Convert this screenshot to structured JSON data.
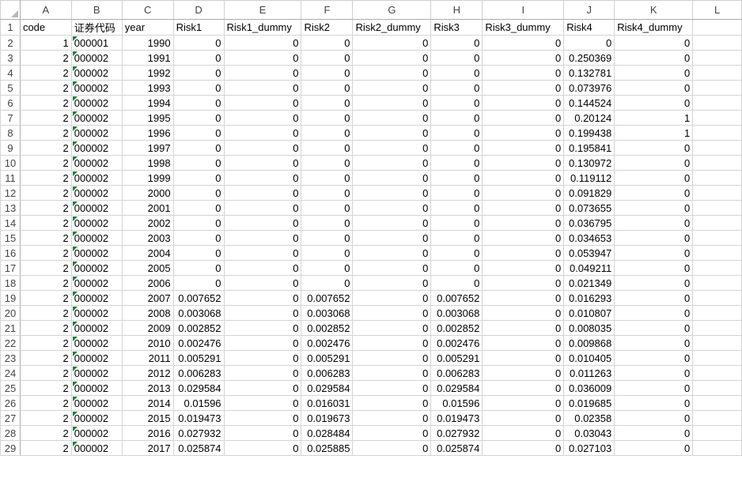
{
  "columns": [
    "A",
    "B",
    "C",
    "D",
    "E",
    "F",
    "G",
    "H",
    "I",
    "J",
    "K",
    "L"
  ],
  "header_row": [
    "code",
    "证券代码",
    "year",
    "Risk1",
    "Risk1_dummy",
    "Risk2",
    "Risk2_dummy",
    "Risk3",
    "Risk3_dummy",
    "Risk4",
    "Risk4_dummy",
    ""
  ],
  "rows": [
    [
      "1",
      "000001",
      "1990",
      "0",
      "0",
      "0",
      "0",
      "0",
      "0",
      "0",
      "0"
    ],
    [
      "2",
      "000002",
      "1991",
      "0",
      "0",
      "0",
      "0",
      "0",
      "0",
      "0.250369",
      "0"
    ],
    [
      "2",
      "000002",
      "1992",
      "0",
      "0",
      "0",
      "0",
      "0",
      "0",
      "0.132781",
      "0"
    ],
    [
      "2",
      "000002",
      "1993",
      "0",
      "0",
      "0",
      "0",
      "0",
      "0",
      "0.073976",
      "0"
    ],
    [
      "2",
      "000002",
      "1994",
      "0",
      "0",
      "0",
      "0",
      "0",
      "0",
      "0.144524",
      "0"
    ],
    [
      "2",
      "000002",
      "1995",
      "0",
      "0",
      "0",
      "0",
      "0",
      "0",
      "0.20124",
      "1"
    ],
    [
      "2",
      "000002",
      "1996",
      "0",
      "0",
      "0",
      "0",
      "0",
      "0",
      "0.199438",
      "1"
    ],
    [
      "2",
      "000002",
      "1997",
      "0",
      "0",
      "0",
      "0",
      "0",
      "0",
      "0.195841",
      "0"
    ],
    [
      "2",
      "000002",
      "1998",
      "0",
      "0",
      "0",
      "0",
      "0",
      "0",
      "0.130972",
      "0"
    ],
    [
      "2",
      "000002",
      "1999",
      "0",
      "0",
      "0",
      "0",
      "0",
      "0",
      "0.119112",
      "0"
    ],
    [
      "2",
      "000002",
      "2000",
      "0",
      "0",
      "0",
      "0",
      "0",
      "0",
      "0.091829",
      "0"
    ],
    [
      "2",
      "000002",
      "2001",
      "0",
      "0",
      "0",
      "0",
      "0",
      "0",
      "0.073655",
      "0"
    ],
    [
      "2",
      "000002",
      "2002",
      "0",
      "0",
      "0",
      "0",
      "0",
      "0",
      "0.036795",
      "0"
    ],
    [
      "2",
      "000002",
      "2003",
      "0",
      "0",
      "0",
      "0",
      "0",
      "0",
      "0.034653",
      "0"
    ],
    [
      "2",
      "000002",
      "2004",
      "0",
      "0",
      "0",
      "0",
      "0",
      "0",
      "0.053947",
      "0"
    ],
    [
      "2",
      "000002",
      "2005",
      "0",
      "0",
      "0",
      "0",
      "0",
      "0",
      "0.049211",
      "0"
    ],
    [
      "2",
      "000002",
      "2006",
      "0",
      "0",
      "0",
      "0",
      "0",
      "0",
      "0.021349",
      "0"
    ],
    [
      "2",
      "000002",
      "2007",
      "0.007652",
      "0",
      "0.007652",
      "0",
      "0.007652",
      "0",
      "0.016293",
      "0"
    ],
    [
      "2",
      "000002",
      "2008",
      "0.003068",
      "0",
      "0.003068",
      "0",
      "0.003068",
      "0",
      "0.010807",
      "0"
    ],
    [
      "2",
      "000002",
      "2009",
      "0.002852",
      "0",
      "0.002852",
      "0",
      "0.002852",
      "0",
      "0.008035",
      "0"
    ],
    [
      "2",
      "000002",
      "2010",
      "0.002476",
      "0",
      "0.002476",
      "0",
      "0.002476",
      "0",
      "0.009868",
      "0"
    ],
    [
      "2",
      "000002",
      "2011",
      "0.005291",
      "0",
      "0.005291",
      "0",
      "0.005291",
      "0",
      "0.010405",
      "0"
    ],
    [
      "2",
      "000002",
      "2012",
      "0.006283",
      "0",
      "0.006283",
      "0",
      "0.006283",
      "0",
      "0.011263",
      "0"
    ],
    [
      "2",
      "000002",
      "2013",
      "0.029584",
      "0",
      "0.029584",
      "0",
      "0.029584",
      "0",
      "0.036009",
      "0"
    ],
    [
      "2",
      "000002",
      "2014",
      "0.01596",
      "0",
      "0.016031",
      "0",
      "0.01596",
      "0",
      "0.019685",
      "0"
    ],
    [
      "2",
      "000002",
      "2015",
      "0.019473",
      "0",
      "0.019673",
      "0",
      "0.019473",
      "0",
      "0.02358",
      "0"
    ],
    [
      "2",
      "000002",
      "2016",
      "0.027932",
      "0",
      "0.028484",
      "0",
      "0.027932",
      "0",
      "0.03043",
      "0"
    ],
    [
      "2",
      "000002",
      "2017",
      "0.025874",
      "0",
      "0.025885",
      "0",
      "0.025874",
      "0",
      "0.027103",
      "0"
    ]
  ]
}
